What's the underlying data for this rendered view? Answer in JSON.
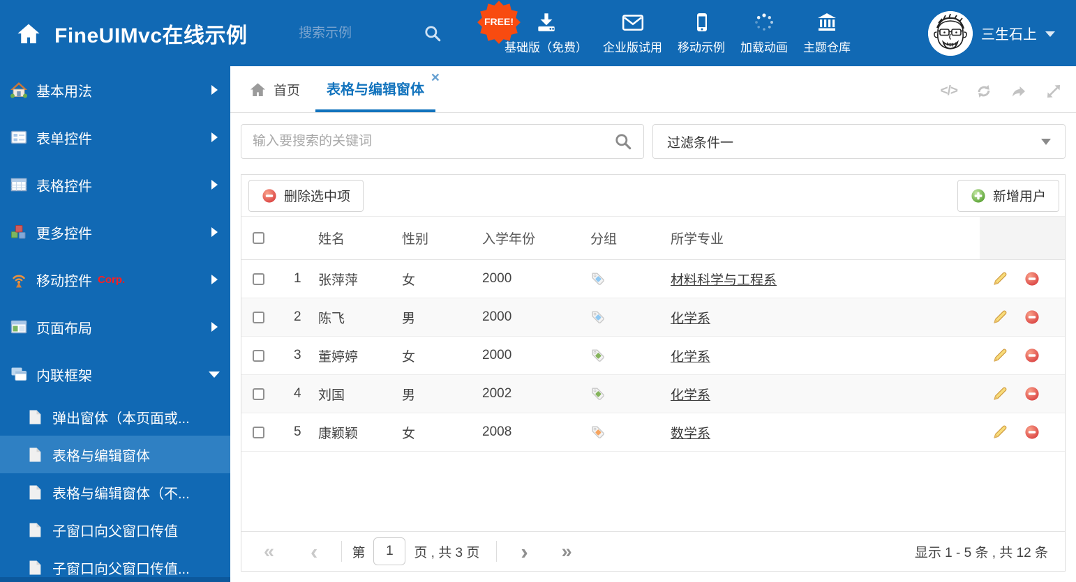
{
  "colors": {
    "primary_blue": "#1169b4",
    "active_item_blue": "#2f80c3",
    "tab_blue": "#1273bd",
    "badge_orange": "#f84b10",
    "tag_blue": "#8fc8f2",
    "tag_green": "#85b45c",
    "tag_orange": "#f6a45f"
  },
  "header": {
    "title": "FineUIMvc在线示例",
    "search_placeholder": "搜索示例",
    "free_badge": "FREE!",
    "nav": [
      {
        "label": "基础版（免费）",
        "icon": "download-icon"
      },
      {
        "label": "企业版试用",
        "icon": "envelope-icon"
      },
      {
        "label": "移动示例",
        "icon": "mobile-icon"
      },
      {
        "label": "加载动画",
        "icon": "spinner-icon"
      },
      {
        "label": "主题仓库",
        "icon": "bank-icon"
      }
    ],
    "user_name": "三生石上"
  },
  "sidebar": {
    "items": [
      {
        "label": "基本用法",
        "icon": "home-icon"
      },
      {
        "label": "表单控件",
        "icon": "form-icon"
      },
      {
        "label": "表格控件",
        "icon": "table-icon"
      },
      {
        "label": "更多控件",
        "icon": "cubes-icon"
      },
      {
        "label": "移动控件",
        "badge": "Corp.",
        "icon": "antenna-icon"
      },
      {
        "label": "页面布局",
        "icon": "layout-icon"
      },
      {
        "label": "内联框架",
        "icon": "frames-icon"
      }
    ],
    "subitems": [
      {
        "label": "弹出窗体（本页面或..."
      },
      {
        "label": "表格与编辑窗体"
      },
      {
        "label": "表格与编辑窗体（不..."
      },
      {
        "label": "子窗口向父窗口传值"
      },
      {
        "label": "子窗口向父窗口传值..."
      }
    ]
  },
  "tabs": {
    "home": "首页",
    "active": "表格与编辑窗体"
  },
  "filters": {
    "keyword_placeholder": "输入要搜索的关键词",
    "filter_selected": "过滤条件一"
  },
  "grid": {
    "delete_button": "删除选中项",
    "add_button": "新增用户",
    "columns": [
      "姓名",
      "性别",
      "入学年份",
      "分组",
      "所学专业"
    ],
    "rows": [
      {
        "num": "1",
        "name": "张萍萍",
        "gender": "女",
        "year": "2000",
        "tag": "blue",
        "major": "材料科学与工程系"
      },
      {
        "num": "2",
        "name": "陈飞",
        "gender": "男",
        "year": "2000",
        "tag": "blue",
        "major": "化学系"
      },
      {
        "num": "3",
        "name": "董婷婷",
        "gender": "女",
        "year": "2000",
        "tag": "green",
        "major": "化学系"
      },
      {
        "num": "4",
        "name": "刘国",
        "gender": "男",
        "year": "2002",
        "tag": "green",
        "major": "化学系"
      },
      {
        "num": "5",
        "name": "康颖颖",
        "gender": "女",
        "year": "2008",
        "tag": "orange",
        "major": "数学系"
      }
    ],
    "pager": {
      "page_prefix": "第",
      "page_value": "1",
      "page_suffix": "页 , 共 3 页",
      "summary": "显示 1 - 5 条 , 共 12 条"
    }
  }
}
